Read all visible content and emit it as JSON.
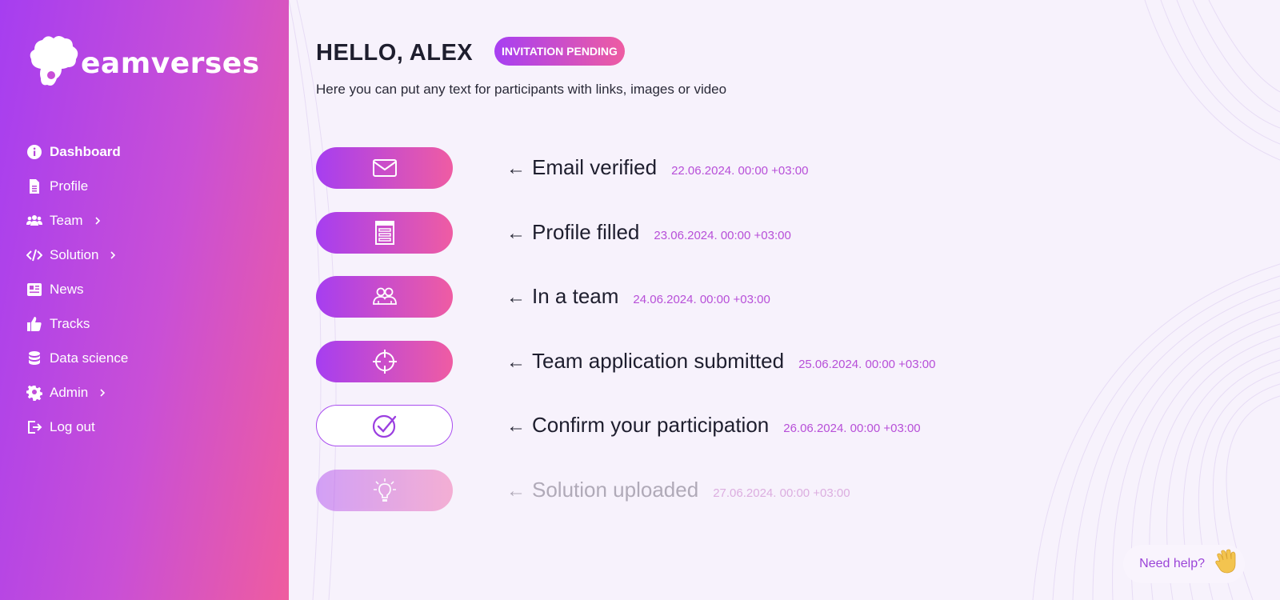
{
  "brand": {
    "name": "eamverses"
  },
  "sidebar": {
    "items": [
      {
        "label": "Dashboard",
        "icon": "info-icon",
        "active": true,
        "has_submenu": false
      },
      {
        "label": "Profile",
        "icon": "document-icon",
        "active": false,
        "has_submenu": false
      },
      {
        "label": "Team",
        "icon": "users-icon",
        "active": false,
        "has_submenu": true
      },
      {
        "label": "Solution",
        "icon": "code-icon",
        "active": false,
        "has_submenu": true
      },
      {
        "label": "News",
        "icon": "newspaper-icon",
        "active": false,
        "has_submenu": false
      },
      {
        "label": "Tracks",
        "icon": "thumbs-up-icon",
        "active": false,
        "has_submenu": false
      },
      {
        "label": "Data science",
        "icon": "database-icon",
        "active": false,
        "has_submenu": false
      },
      {
        "label": "Admin",
        "icon": "gear-icon",
        "active": false,
        "has_submenu": true
      },
      {
        "label": "Log out",
        "icon": "logout-icon",
        "active": false,
        "has_submenu": false
      }
    ]
  },
  "header": {
    "greeting": "HELLO, ALEX",
    "status_badge": "INVITATION PENDING",
    "intro": "Here you can put any text for participants with links, images or video"
  },
  "steps": [
    {
      "title": "Email verified",
      "date": "22.06.2024. 00:00 +03:00",
      "icon": "envelope-icon",
      "state": "done"
    },
    {
      "title": "Profile filled",
      "date": "23.06.2024. 00:00 +03:00",
      "icon": "form-icon",
      "state": "done"
    },
    {
      "title": "In a team",
      "date": "24.06.2024. 00:00 +03:00",
      "icon": "team-icon",
      "state": "done"
    },
    {
      "title": "Team application submitted",
      "date": "25.06.2024. 00:00 +03:00",
      "icon": "crosshair-icon",
      "state": "done"
    },
    {
      "title": "Confirm your participation",
      "date": "26.06.2024. 00:00 +03:00",
      "icon": "check-circle-icon",
      "state": "current"
    },
    {
      "title": "Solution uploaded",
      "date": "27.06.2024. 00:00 +03:00",
      "icon": "lightbulb-icon",
      "state": "pending"
    }
  ],
  "arrow_glyph": "←",
  "help": {
    "label": "Need help?",
    "icon": "waving-hand-icon"
  },
  "colors": {
    "accent_start": "#a63ef0",
    "accent_end": "#ef5ca3",
    "date": "#b74fd8",
    "background": "#f7f2fc"
  }
}
